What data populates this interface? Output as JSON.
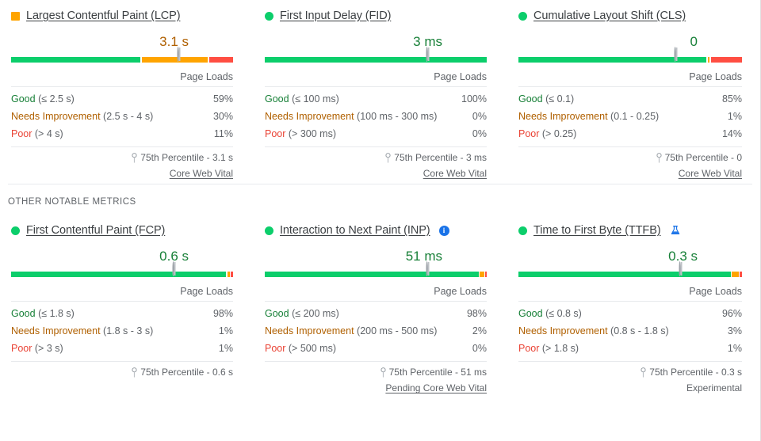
{
  "colors": {
    "good": "#0cce6b",
    "needs_improvement": "#ffa400",
    "poor": "#ff4e42",
    "good_text": "#188038",
    "ni_text": "#b06000",
    "poor_text": "#ea4335",
    "info_blue": "#1a73e8"
  },
  "core_section": {
    "metrics": [
      {
        "title": "Largest Contentful Paint (LCP)",
        "status_icon": "square",
        "status_color": "#ffa400",
        "value": "3.1 s",
        "value_color": "#b06000",
        "pin_percent": 76,
        "bar": [
          {
            "color": "#0cce6b",
            "percent": 59
          },
          {
            "color": "#ffa400",
            "percent": 30
          },
          {
            "color": "#ff4e42",
            "percent": 11
          }
        ],
        "page_loads_label": "Page Loads",
        "rows": [
          {
            "label": "Good",
            "label_class": "lbl-good",
            "range": "(≤ 2.5 s)",
            "percent": "59%"
          },
          {
            "label": "Needs Improvement",
            "label_class": "lbl-ni",
            "range": "(2.5 s - 4 s)",
            "percent": "30%"
          },
          {
            "label": "Poor",
            "label_class": "lbl-poor",
            "range": "(> 4 s)",
            "percent": "11%"
          }
        ],
        "percentile": "75th Percentile - 3.1 s",
        "footer": "Core Web Vital",
        "footer_link": true,
        "badge": "none"
      },
      {
        "title": "First Input Delay (FID)",
        "status_icon": "circle",
        "status_color": "#0cce6b",
        "value": "3 ms",
        "value_color": "#188038",
        "pin_percent": 74,
        "bar": [
          {
            "color": "#0cce6b",
            "percent": 100
          }
        ],
        "page_loads_label": "Page Loads",
        "rows": [
          {
            "label": "Good",
            "label_class": "lbl-good",
            "range": "(≤ 100 ms)",
            "percent": "100%"
          },
          {
            "label": "Needs Improvement",
            "label_class": "lbl-ni",
            "range": "(100 ms - 300 ms)",
            "percent": "0%"
          },
          {
            "label": "Poor",
            "label_class": "lbl-poor",
            "range": "(> 300 ms)",
            "percent": "0%"
          }
        ],
        "percentile": "75th Percentile - 3 ms",
        "footer": "Core Web Vital",
        "footer_link": true,
        "badge": "none"
      },
      {
        "title": "Cumulative Layout Shift (CLS)",
        "status_icon": "circle",
        "status_color": "#0cce6b",
        "value": "0",
        "value_color": "#188038",
        "pin_percent": 71,
        "bar": [
          {
            "color": "#0cce6b",
            "percent": 85
          },
          {
            "color": "#ffa400",
            "percent": 1
          },
          {
            "color": "#ff4e42",
            "percent": 14
          }
        ],
        "page_loads_label": "Page Loads",
        "rows": [
          {
            "label": "Good",
            "label_class": "lbl-good",
            "range": "(≤ 0.1)",
            "percent": "85%"
          },
          {
            "label": "Needs Improvement",
            "label_class": "lbl-ni",
            "range": "(0.1 - 0.25)",
            "percent": "1%"
          },
          {
            "label": "Poor",
            "label_class": "lbl-poor",
            "range": "(> 0.25)",
            "percent": "14%"
          }
        ],
        "percentile": "75th Percentile - 0",
        "footer": "Core Web Vital",
        "footer_link": true,
        "badge": "none"
      }
    ]
  },
  "other_section": {
    "label": "OTHER NOTABLE METRICS",
    "metrics": [
      {
        "title": "First Contentful Paint (FCP)",
        "status_icon": "circle",
        "status_color": "#0cce6b",
        "value": "0.6 s",
        "value_color": "#188038",
        "pin_percent": 74,
        "bar": [
          {
            "color": "#0cce6b",
            "percent": 98
          },
          {
            "color": "#ffa400",
            "percent": 1
          },
          {
            "color": "#ff4e42",
            "percent": 1
          }
        ],
        "page_loads_label": "Page Loads",
        "rows": [
          {
            "label": "Good",
            "label_class": "lbl-good",
            "range": "(≤ 1.8 s)",
            "percent": "98%"
          },
          {
            "label": "Needs Improvement",
            "label_class": "lbl-ni",
            "range": "(1.8 s - 3 s)",
            "percent": "1%"
          },
          {
            "label": "Poor",
            "label_class": "lbl-poor",
            "range": "(> 3 s)",
            "percent": "1%"
          }
        ],
        "percentile": "75th Percentile - 0.6 s",
        "footer": "",
        "footer_link": false,
        "badge": "none"
      },
      {
        "title": "Interaction to Next Paint (INP)",
        "status_icon": "circle",
        "status_color": "#0cce6b",
        "value": "51 ms",
        "value_color": "#188038",
        "pin_percent": 74,
        "bar": [
          {
            "color": "#0cce6b",
            "percent": 98
          },
          {
            "color": "#ffa400",
            "percent": 2
          },
          {
            "color": "#ff4e42",
            "percent": 0.7
          }
        ],
        "page_loads_label": "Page Loads",
        "rows": [
          {
            "label": "Good",
            "label_class": "lbl-good",
            "range": "(≤ 200 ms)",
            "percent": "98%"
          },
          {
            "label": "Needs Improvement",
            "label_class": "lbl-ni",
            "range": "(200 ms - 500 ms)",
            "percent": "2%"
          },
          {
            "label": "Poor",
            "label_class": "lbl-poor",
            "range": "(> 500 ms)",
            "percent": "0%"
          }
        ],
        "percentile": "75th Percentile - 51 ms",
        "footer": "Pending Core Web Vital",
        "footer_link": true,
        "badge": "info"
      },
      {
        "title": "Time to First Byte (TTFB)",
        "status_icon": "circle",
        "status_color": "#0cce6b",
        "value": "0.3 s",
        "value_color": "#188038",
        "pin_percent": 73,
        "bar": [
          {
            "color": "#0cce6b",
            "percent": 96
          },
          {
            "color": "#ffa400",
            "percent": 3
          },
          {
            "color": "#ff4e42",
            "percent": 1
          }
        ],
        "page_loads_label": "Page Loads",
        "rows": [
          {
            "label": "Good",
            "label_class": "lbl-good",
            "range": "(≤ 0.8 s)",
            "percent": "96%"
          },
          {
            "label": "Needs Improvement",
            "label_class": "lbl-ni",
            "range": "(0.8 s - 1.8 s)",
            "percent": "3%"
          },
          {
            "label": "Poor",
            "label_class": "lbl-poor",
            "range": "(> 1.8 s)",
            "percent": "1%"
          }
        ],
        "percentile": "75th Percentile - 0.3 s",
        "footer": "Experimental",
        "footer_link": false,
        "badge": "flask"
      }
    ]
  }
}
